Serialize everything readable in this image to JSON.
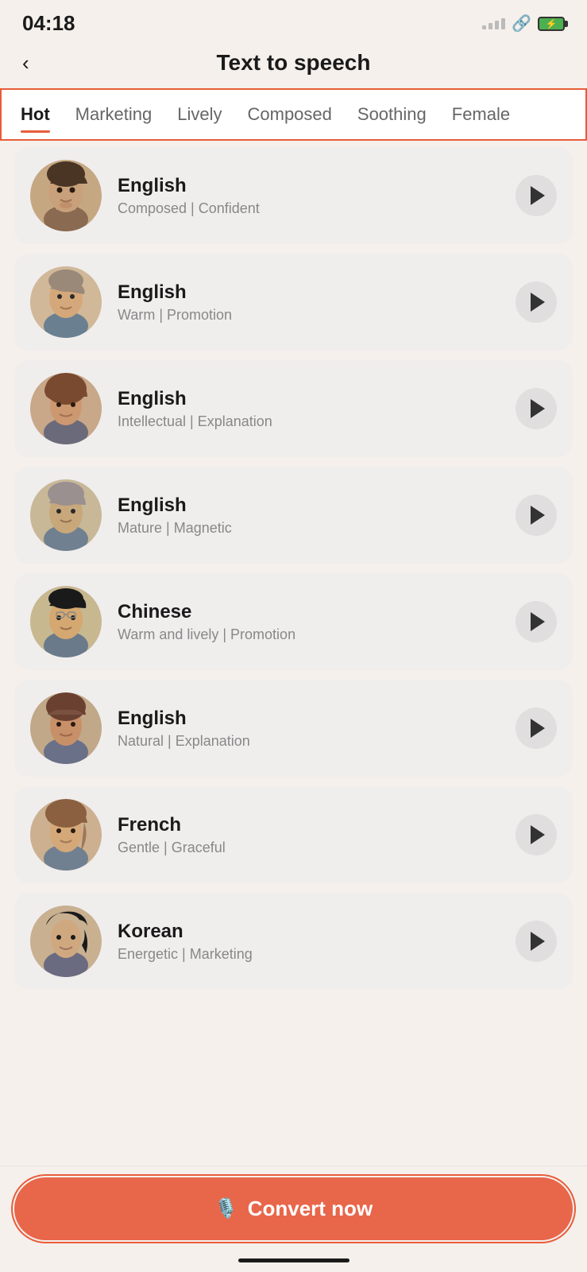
{
  "status": {
    "time": "04:18"
  },
  "header": {
    "back_label": "‹",
    "title": "Text to speech"
  },
  "tabs": [
    {
      "id": "hot",
      "label": "Hot",
      "active": true
    },
    {
      "id": "marketing",
      "label": "Marketing",
      "active": false
    },
    {
      "id": "lively",
      "label": "Lively",
      "active": false
    },
    {
      "id": "composed",
      "label": "Composed",
      "active": false
    },
    {
      "id": "soothing",
      "label": "Soothing",
      "active": false
    },
    {
      "id": "female",
      "label": "Female",
      "active": false
    }
  ],
  "voices": [
    {
      "id": 1,
      "language": "English",
      "tag1": "Composed",
      "tag2": "Confident",
      "gender": "male",
      "skin": "#b8856a",
      "hair": "#4a3728"
    },
    {
      "id": 2,
      "language": "English",
      "tag1": "Warm",
      "tag2": "Promotion",
      "gender": "male",
      "skin": "#c49a7a",
      "hair": "#8a7060"
    },
    {
      "id": 3,
      "language": "English",
      "tag1": "Intellectual",
      "tag2": "Explanation",
      "gender": "female",
      "skin": "#c9956a",
      "hair": "#7a4a30"
    },
    {
      "id": 4,
      "language": "English",
      "tag1": "Mature",
      "tag2": "Magnetic",
      "gender": "male",
      "skin": "#c0a080",
      "hair": "#888"
    },
    {
      "id": 5,
      "language": "Chinese",
      "tag1": "Warm and lively",
      "tag2": "Promotion",
      "gender": "male",
      "skin": "#d4a870",
      "hair": "#1a1a1a"
    },
    {
      "id": 6,
      "language": "English",
      "tag1": "Natural",
      "tag2": "Explanation",
      "gender": "female",
      "skin": "#c08860",
      "hair": "#6a4030"
    },
    {
      "id": 7,
      "language": "French",
      "tag1": "Gentle",
      "tag2": "Graceful",
      "gender": "female",
      "skin": "#d4a878",
      "hair": "#8a6040"
    },
    {
      "id": 8,
      "language": "Korean",
      "tag1": "Energetic",
      "tag2": "Marketing",
      "gender": "female",
      "skin": "#d8b090",
      "hair": "#1a1a1a"
    }
  ],
  "convert_button": {
    "label": "Convert now",
    "icon": "🎙"
  }
}
